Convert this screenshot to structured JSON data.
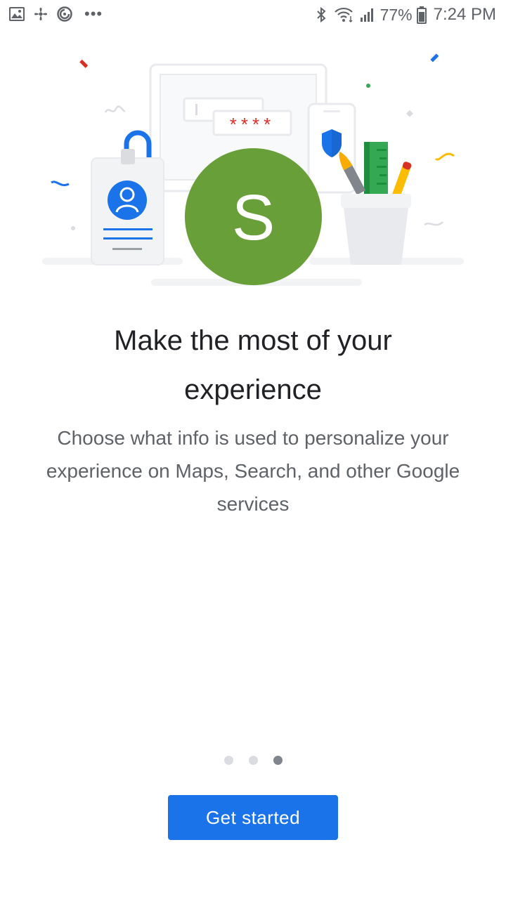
{
  "status_bar": {
    "left_icons": [
      "image-icon",
      "fan-icon",
      "sync-icon",
      "more-dots-icon"
    ],
    "more_dots": "•••",
    "right_icons": [
      "bluetooth-icon",
      "wifi-icon",
      "signal-icon",
      "battery-icon"
    ],
    "battery_percent": "77%",
    "time": "7:24 PM"
  },
  "hero": {
    "avatar_letter": "S",
    "password_mask": "****",
    "colors": {
      "avatar": "#689f38",
      "blue": "#1a73e8",
      "red": "#d93025",
      "green": "#34a853",
      "yellow": "#fbbc04"
    }
  },
  "content": {
    "title_line1": "Make the most of your",
    "title_line2": "experience",
    "description": "Choose what info is used to personalize your experience on Maps, Search, and other Google services"
  },
  "pager": {
    "total_pages": 3,
    "current_page": 3
  },
  "actions": {
    "get_started_label": "Get started"
  }
}
